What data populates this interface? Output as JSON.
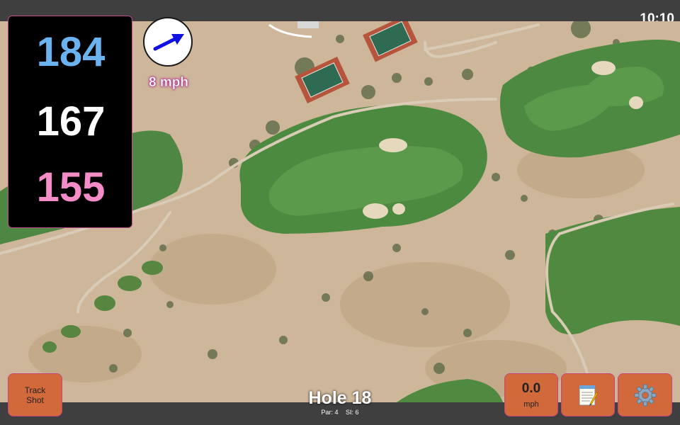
{
  "status_bar": {
    "time": "10:10"
  },
  "yardage": {
    "back": "184",
    "middle": "167",
    "front": "155",
    "colors": {
      "back": "#6bb2f0",
      "middle": "#ffffff",
      "front": "#f48cc8"
    }
  },
  "wind": {
    "speed": "8 mph",
    "arrow_icon": "wind-direction-arrow-icon",
    "arrow_color": "#1010e0"
  },
  "buttons": {
    "track_shot_line1": "Track",
    "track_shot_line2": "Shot",
    "speed_value": "0.0",
    "speed_unit": "mph",
    "notes_icon": "notepad-icon",
    "settings_icon": "gear-icon"
  },
  "hole": {
    "title": "Hole 18",
    "par": "Par: 4",
    "si": "SI: 6"
  },
  "colors": {
    "button_bg": "#d2693a",
    "bar_bg": "#3f3f3f",
    "map_sand": "#cbb497",
    "map_green": "#4f8a40"
  }
}
